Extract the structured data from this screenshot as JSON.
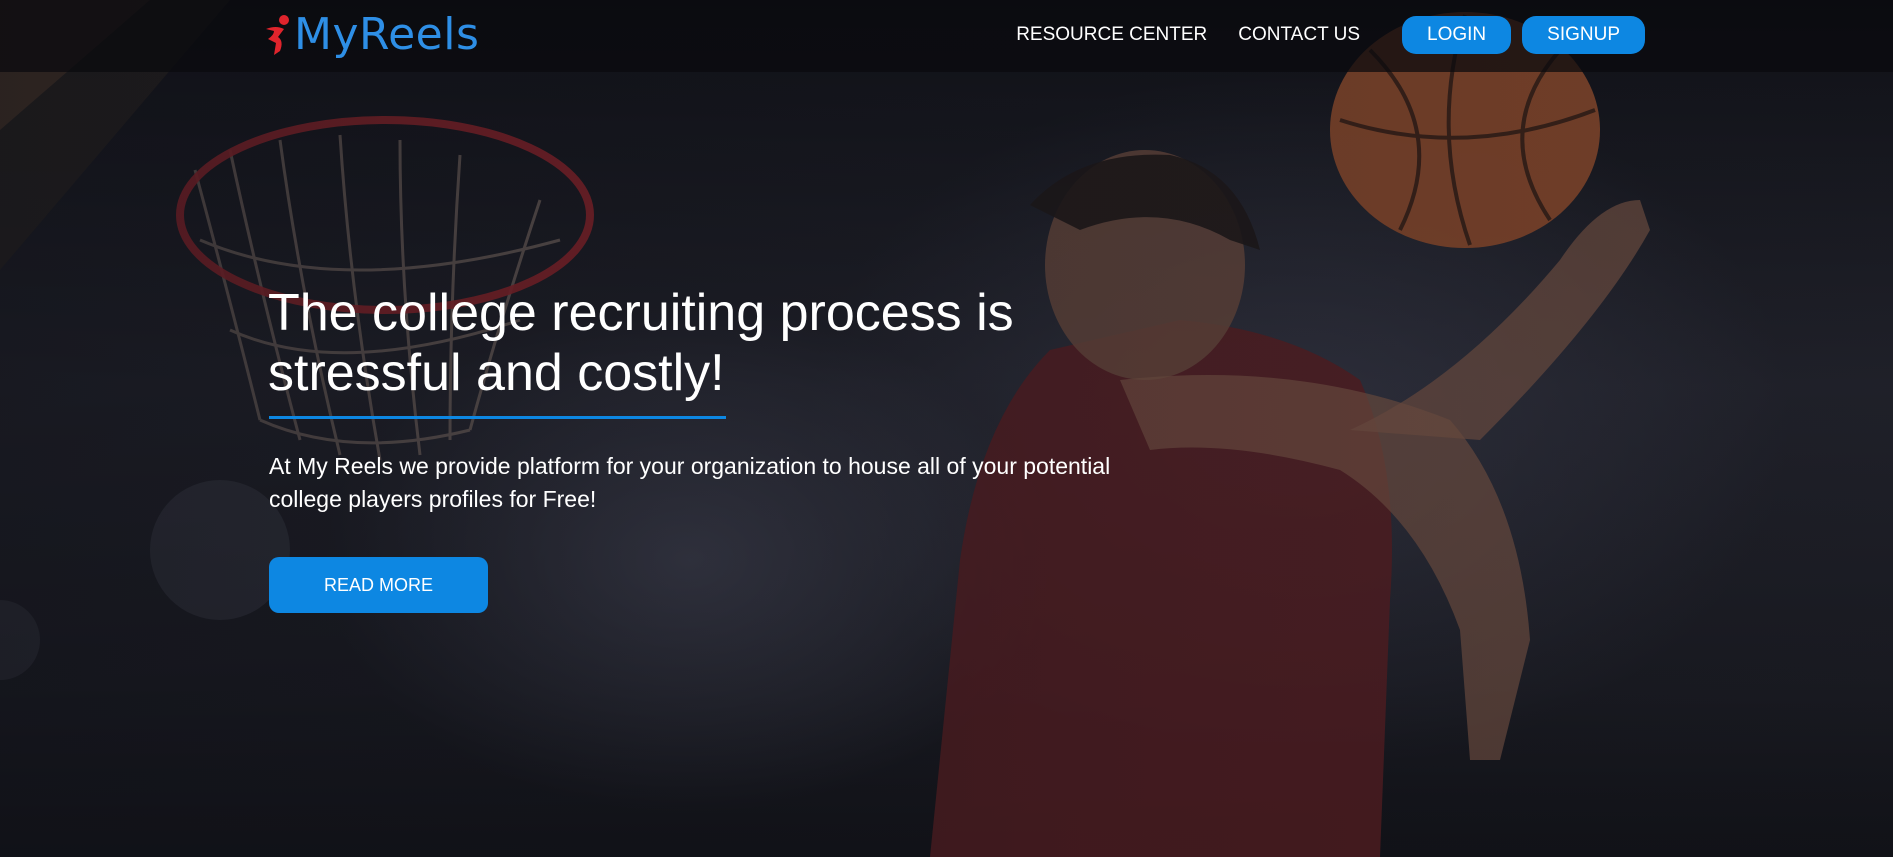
{
  "brand": {
    "name": "MyReels",
    "color": "#2e8fe6",
    "mark_color": "#e0242c"
  },
  "nav": {
    "resource_center": "RESOURCE CENTER",
    "contact_us": "CONTACT US",
    "login": "LOGIN",
    "signup": "SIGNUP"
  },
  "hero": {
    "headline": "The college recruiting process is stressful and costly!",
    "description": "At My Reels we provide platform for your organization to house all of your potential college players profiles for Free!",
    "cta": "READ MORE",
    "background_image": "basketball-player-dunking-photo"
  },
  "colors": {
    "accent": "#0d87e2",
    "overlay": "#14151b",
    "text": "#ffffff"
  }
}
